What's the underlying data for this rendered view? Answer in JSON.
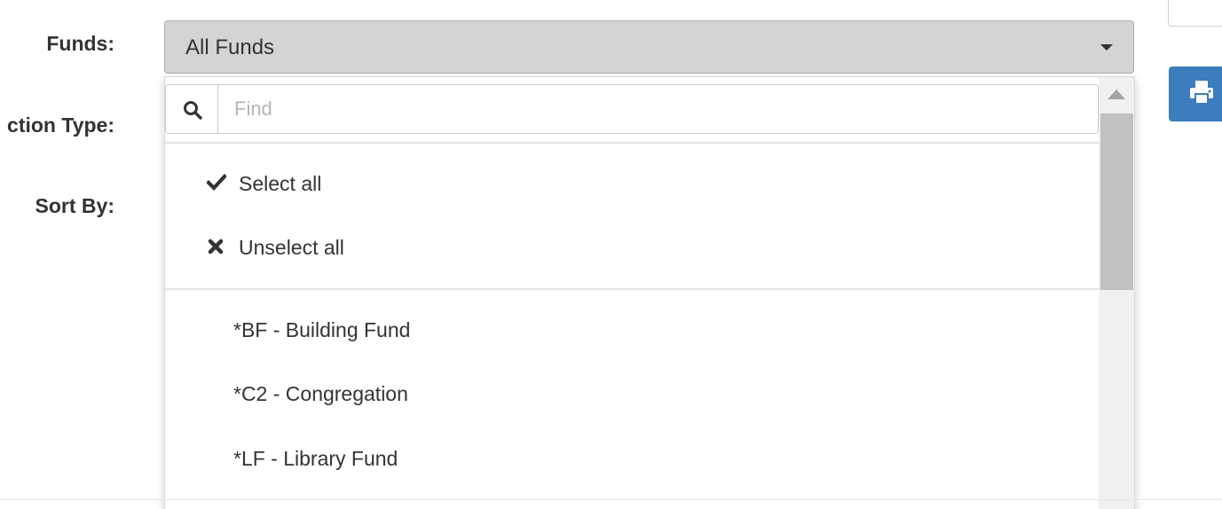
{
  "form": {
    "funds_label": "Funds:",
    "transaction_type_label": "ction Type:",
    "sort_by_label": "Sort By:"
  },
  "funds_select": {
    "selected_value": "All Funds",
    "search_placeholder": "Find",
    "search_value": "",
    "select_all_label": "Select all",
    "unselect_all_label": "Unselect all",
    "options": [
      {
        "label": "*BF - Building Fund"
      },
      {
        "label": "*C2 - Congregation"
      },
      {
        "label": "*LF - Library Fund"
      }
    ]
  },
  "icons": {
    "search": "search-icon",
    "check": "check-icon",
    "unselect": "times-icon",
    "caret": "caret-down-icon",
    "print": "print-icon"
  },
  "colors": {
    "select_background": "#d4d4d4",
    "print_button": "#3b7dbd",
    "text": "#333333",
    "placeholder": "#b5b5b5"
  }
}
